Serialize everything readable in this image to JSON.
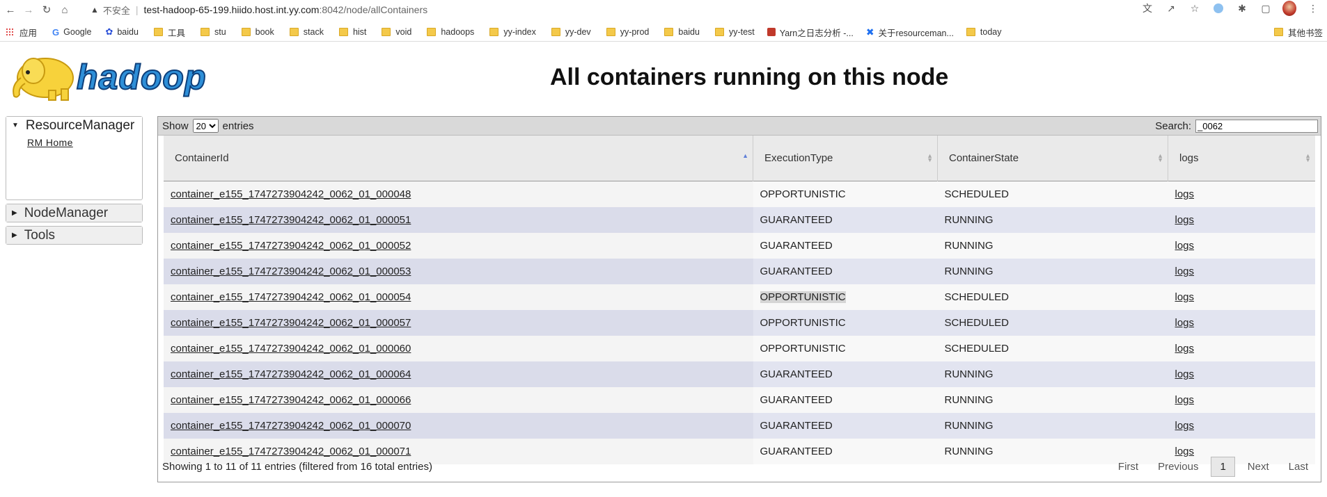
{
  "browser": {
    "insecure_label": "不安全",
    "url_host": "test-hadoop-65-199.hiido.host.int.yy.com",
    "url_path": ":8042/node/allContainers",
    "bookmarks": [
      {
        "label": "应用",
        "icon": "apps-icon"
      },
      {
        "label": "Google",
        "icon": "google-icon"
      },
      {
        "label": "baidu",
        "icon": "baidu-paw-icon"
      },
      {
        "label": "工具",
        "icon": "folder-icon"
      },
      {
        "label": "stu",
        "icon": "folder-icon"
      },
      {
        "label": "book",
        "icon": "folder-icon"
      },
      {
        "label": "stack",
        "icon": "folder-icon"
      },
      {
        "label": "hist",
        "icon": "folder-icon"
      },
      {
        "label": "void",
        "icon": "folder-icon"
      },
      {
        "label": "hadoops",
        "icon": "folder-icon"
      },
      {
        "label": "yy-index",
        "icon": "folder-icon"
      },
      {
        "label": "yy-dev",
        "icon": "folder-icon"
      },
      {
        "label": "yy-prod",
        "icon": "folder-icon"
      },
      {
        "label": "baidu",
        "icon": "folder-icon"
      },
      {
        "label": "yy-test",
        "icon": "folder-icon"
      },
      {
        "label": "Yarn之日志分析 -...",
        "icon": "red-page-icon"
      },
      {
        "label": "关于resourceman...",
        "icon": "blue-x-icon"
      },
      {
        "label": "today",
        "icon": "folder-icon"
      }
    ],
    "other_bookmarks": "其他书签"
  },
  "header": {
    "logo_text": "hadoop",
    "title": "All containers running on this node"
  },
  "nav": {
    "resource_manager": "ResourceManager",
    "rm_home": "RM Home",
    "node_manager": "NodeManager",
    "tools": "Tools"
  },
  "table": {
    "show_label": "Show",
    "entries_label": "entries",
    "page_size": "20",
    "search_label": "Search:",
    "search_value": "_0062",
    "columns": [
      "ContainerId",
      "ExecutionType",
      "ContainerState",
      "logs"
    ],
    "rows": [
      {
        "id": "container_e155_1747273904242_0062_01_000048",
        "type": "OPPORTUNISTIC",
        "state": "SCHEDULED",
        "logs": "logs"
      },
      {
        "id": "container_e155_1747273904242_0062_01_000051",
        "type": "GUARANTEED",
        "state": "RUNNING",
        "logs": "logs"
      },
      {
        "id": "container_e155_1747273904242_0062_01_000052",
        "type": "GUARANTEED",
        "state": "RUNNING",
        "logs": "logs"
      },
      {
        "id": "container_e155_1747273904242_0062_01_000053",
        "type": "GUARANTEED",
        "state": "RUNNING",
        "logs": "logs"
      },
      {
        "id": "container_e155_1747273904242_0062_01_000054",
        "type": "OPPORTUNISTIC",
        "state": "SCHEDULED",
        "logs": "logs"
      },
      {
        "id": "container_e155_1747273904242_0062_01_000057",
        "type": "OPPORTUNISTIC",
        "state": "SCHEDULED",
        "logs": "logs"
      },
      {
        "id": "container_e155_1747273904242_0062_01_000060",
        "type": "OPPORTUNISTIC",
        "state": "SCHEDULED",
        "logs": "logs"
      },
      {
        "id": "container_e155_1747273904242_0062_01_000064",
        "type": "GUARANTEED",
        "state": "RUNNING",
        "logs": "logs"
      },
      {
        "id": "container_e155_1747273904242_0062_01_000066",
        "type": "GUARANTEED",
        "state": "RUNNING",
        "logs": "logs"
      },
      {
        "id": "container_e155_1747273904242_0062_01_000070",
        "type": "GUARANTEED",
        "state": "RUNNING",
        "logs": "logs"
      },
      {
        "id": "container_e155_1747273904242_0062_01_000071",
        "type": "GUARANTEED",
        "state": "RUNNING",
        "logs": "logs"
      }
    ],
    "info": "Showing 1 to 11 of 11 entries (filtered from 16 total entries)",
    "pager": {
      "first": "First",
      "previous": "Previous",
      "page": "1",
      "next": "Next",
      "last": "Last"
    }
  },
  "colors": {
    "row_alt": "#e2e4f0",
    "header_bg": "#eaeaea",
    "logo_blue": "#2e8fd8"
  }
}
